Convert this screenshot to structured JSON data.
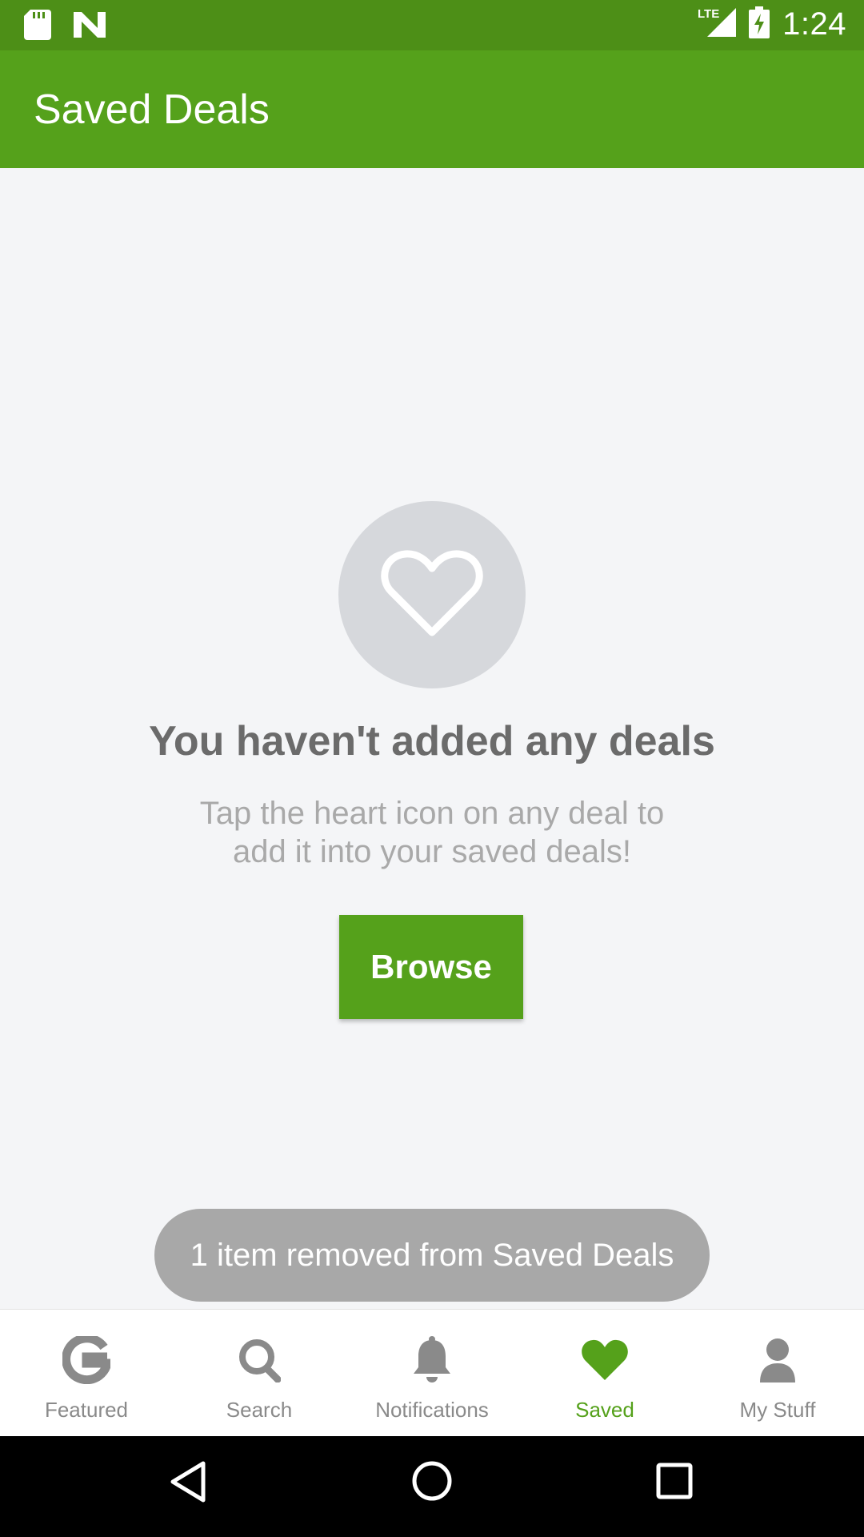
{
  "status_bar": {
    "time": "1:24",
    "network": "LTE",
    "icons": [
      "sd-card-icon",
      "n-logo-icon",
      "signal-icon",
      "battery-charging-icon"
    ]
  },
  "header": {
    "title": "Saved Deals"
  },
  "empty_state": {
    "icon": "heart-outline-icon",
    "title": "You haven't added any deals",
    "description_line1": "Tap the heart icon on any deal to",
    "description_line2": "add it into your saved deals!",
    "button_label": "Browse"
  },
  "toast": {
    "message": "1 item removed from Saved Deals"
  },
  "bottom_nav": {
    "items": [
      {
        "label": "Featured",
        "icon": "g-logo-icon"
      },
      {
        "label": "Search",
        "icon": "search-icon"
      },
      {
        "label": "Notifications",
        "icon": "bell-icon"
      },
      {
        "label": "Saved",
        "icon": "heart-icon",
        "active": true
      },
      {
        "label": "My Stuff",
        "icon": "user-icon"
      }
    ]
  },
  "colors": {
    "brand_green": "#55a11b",
    "status_bar": "#4d8f17",
    "background": "#f4f5f7",
    "inactive": "#8a8a8a"
  }
}
